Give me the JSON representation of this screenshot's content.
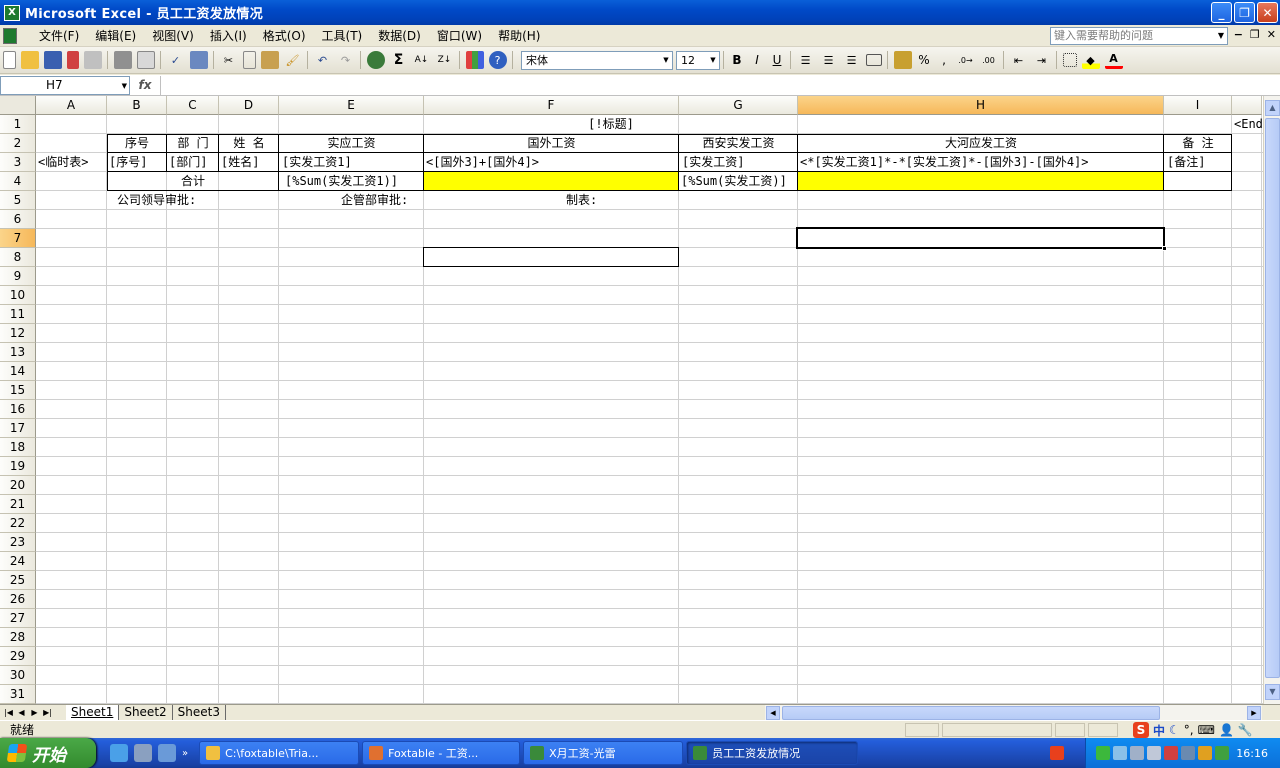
{
  "window": {
    "title": "Microsoft Excel - 员工工资发放情况",
    "app_icon": "X"
  },
  "menu": [
    "文件(F)",
    "编辑(E)",
    "视图(V)",
    "插入(I)",
    "格式(O)",
    "工具(T)",
    "数据(D)",
    "窗口(W)",
    "帮助(H)"
  ],
  "help_placeholder": "键入需要帮助的问题",
  "toolbar": {
    "font_name": "宋体",
    "font_size": "12",
    "bold": "B",
    "italic": "I",
    "underline": "U",
    "percent": "%",
    "comma": ","
  },
  "formula_bar": {
    "name_box": "H7",
    "fx": "fx",
    "content": ""
  },
  "columns": [
    "A",
    "B",
    "C",
    "D",
    "E",
    "F",
    "G",
    "H",
    "I"
  ],
  "rows": [
    "1",
    "2",
    "3",
    "4",
    "5",
    "6",
    "7",
    "8",
    "9",
    "10",
    "11",
    "12",
    "13",
    "14",
    "15",
    "16",
    "17",
    "18",
    "19",
    "20",
    "21",
    "22",
    "23",
    "24",
    "25",
    "26",
    "27",
    "28",
    "29",
    "30",
    "31"
  ],
  "cells": {
    "F1": "[!标题]",
    "J1": "<End",
    "B2": "序号",
    "C2": "部 门",
    "D2": "姓  名",
    "E2": "实应工资",
    "F2": "国外工资",
    "G2": "西安实发工资",
    "H2": "大河应发工资",
    "I2": "备  注",
    "A3": "<临时表>",
    "B3": "[序号]",
    "C3": "[部门]",
    "D3": "[姓名]",
    "E3": "[实发工资1]",
    "F3": "<[国外3]+[国外4]>",
    "G3": "[实发工资]",
    "H3": "<*[实发工资1]*-*[实发工资]*-[国外3]-[国外4]>",
    "I3": "[备注]",
    "B4": "合计",
    "E4": "[%Sum(实发工资1)]",
    "G4": "[%Sum(实发工资)]",
    "B5": "公司领导审批:",
    "E5": "企管部审批:",
    "F5": "制表:"
  },
  "highlight_color": "#ffff00",
  "sheets": [
    "Sheet1",
    "Sheet2",
    "Sheet3"
  ],
  "status": "就绪",
  "ime": {
    "logo": "S",
    "mode": "中"
  },
  "taskbar": {
    "start": "开始",
    "buttons": [
      {
        "label": "C:\\foxtable\\Tria...",
        "active": false
      },
      {
        "label": "Foxtable - 工资...",
        "active": false
      },
      {
        "label": "X月工资-光雷",
        "active": false
      },
      {
        "label": "员工工资发放情况",
        "active": true
      }
    ],
    "clock": "16:16"
  }
}
